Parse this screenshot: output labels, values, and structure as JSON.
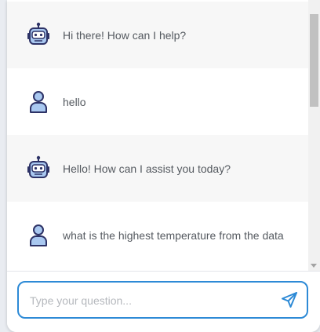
{
  "messages": [
    {
      "role": "bot",
      "avatar": "robot-icon",
      "text": "Hi there! How can I help?"
    },
    {
      "role": "user",
      "avatar": "user-icon",
      "text": "hello"
    },
    {
      "role": "bot",
      "avatar": "robot-icon",
      "text": "Hello! How can I assist you today?"
    },
    {
      "role": "user",
      "avatar": "user-icon",
      "text": "what is the highest temperature from the data"
    }
  ],
  "composer": {
    "placeholder": "Type your question...",
    "send_icon": "send-icon"
  },
  "colors": {
    "accent": "#2d8ad6",
    "avatar_fill": "#a9c8f0",
    "avatar_stroke": "#2d3266",
    "bot_bubble": "#f7f7f7"
  }
}
